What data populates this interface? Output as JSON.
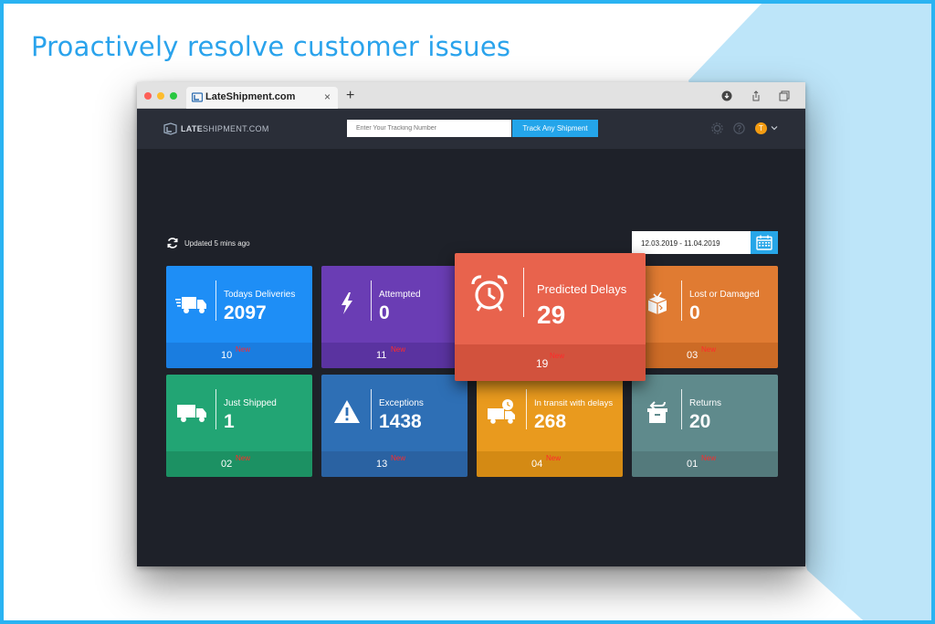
{
  "headline": "Proactively resolve customer issues",
  "browser": {
    "tab_title": "LateShipment.com",
    "tab_close": "×",
    "new_tab": "+"
  },
  "app": {
    "logo_part1": "LATE",
    "logo_part2": "SHIPMENT.COM",
    "search_placeholder": "Enter Your Tracking Number",
    "track_button": "Track Any Shipment",
    "avatar_initial": "T"
  },
  "dashboard": {
    "updated": "Updated 5 mins ago",
    "date_range": "12.03.2019 - 11.04.2019",
    "new_badge": "New",
    "cards": [
      {
        "label": "Todays Deliveries",
        "value": "2097",
        "count": "10",
        "color": "#1e8ef6",
        "bottom_color": "#1a7de0"
      },
      {
        "label": "Attempted",
        "value": "0",
        "count": "11",
        "color": "#6a3db4",
        "bottom_color": "#5a33a0"
      },
      {
        "label": "Lost or Damaged",
        "value": "0",
        "count": "03",
        "color": "#e07b32",
        "bottom_color": "#cc6b26"
      },
      {
        "label": "Just Shipped",
        "value": "1",
        "count": "02",
        "color": "#22a574",
        "bottom_color": "#1c9163"
      },
      {
        "label": "Exceptions",
        "value": "1438",
        "count": "13",
        "color": "#2e6fb5",
        "bottom_color": "#2a62a2"
      },
      {
        "label": "In transit with delays",
        "value": "268",
        "count": "04",
        "color": "#e99a1e",
        "bottom_color": "#d48a14"
      },
      {
        "label": "Returns",
        "value": "20",
        "count": "01",
        "color": "#5f8a8c",
        "bottom_color": "#547a7c"
      }
    ],
    "featured": {
      "label": "Predicted Delays",
      "value": "29",
      "count": "19",
      "color": "#e8634d"
    }
  }
}
